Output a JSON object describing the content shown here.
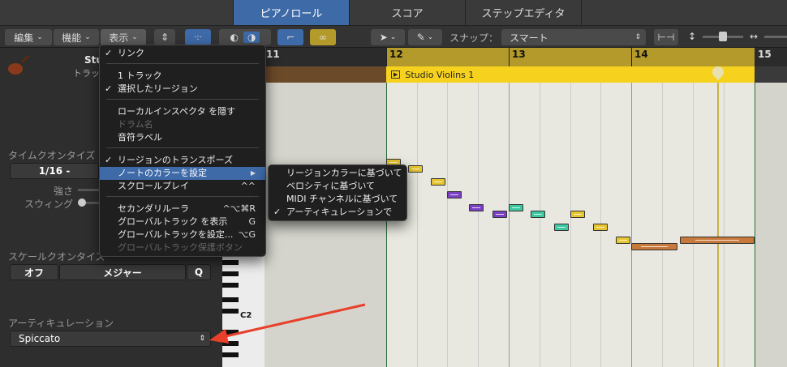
{
  "tabs": [
    {
      "label": "ピアノロール",
      "active": true
    },
    {
      "label": "スコア",
      "active": false
    },
    {
      "label": "ステップエディタ",
      "active": false
    }
  ],
  "toolbar": {
    "edit": "編集",
    "function": "機能",
    "view": "表示",
    "snap_label": "スナップ：",
    "snap_value": "スマート"
  },
  "inspector": {
    "track_title": "Stu",
    "track_subtitle": "トラッ",
    "time_quantize_label": "タイムクオンタイズ",
    "time_quantize_value": "1/16 -",
    "strength_label": "強さ",
    "swing_label": "スウィング",
    "scale_quantize_label": "スケールクオンタイズ",
    "scale_off": "オフ",
    "scale_major": "メジャー",
    "scale_q": "Q",
    "articulation_label": "アーティキュレーション",
    "articulation_value": "Spiccato"
  },
  "piano": {
    "c2_label": "C2"
  },
  "ruler": {
    "bars": [
      "11",
      "12",
      "13",
      "14",
      "15"
    ]
  },
  "region": {
    "name": "Studio Violins 1"
  },
  "view_menu": [
    {
      "label": "リンク",
      "checked": true
    },
    {
      "label": "1 トラック"
    },
    {
      "label": "選択したリージョン",
      "checked": true
    },
    {
      "label": "ローカルインスペクタ を隠す"
    },
    {
      "label": "ドラム名",
      "disabled": true
    },
    {
      "label": "音符ラベル"
    },
    {
      "label": "リージョンのトランスポーズ",
      "checked": true
    },
    {
      "label": "ノートのカラーを設定",
      "highlighted": true,
      "arrow": "▶"
    },
    {
      "label": "スクロールプレイ",
      "shortcut": "^^"
    },
    {
      "label": "セカンダリルーラ",
      "shortcut": "^⌥⌘R"
    },
    {
      "label": "グローバルトラック を表示",
      "shortcut": "G"
    },
    {
      "label": "グローバルトラックを設定...",
      "shortcut": "⌥G"
    },
    {
      "label": "グローバルトラック保護ボタン",
      "disabled": true
    }
  ],
  "color_submenu": [
    {
      "label": "リージョンカラーに基づいて"
    },
    {
      "label": "ベロシティに基づいて"
    },
    {
      "label": "MIDI チャンネルに基づいて"
    },
    {
      "label": "アーティキュレーションで",
      "checked": true
    }
  ],
  "colors": {
    "accent": "#3e6aa8",
    "region": "#f6d21e",
    "note_yellow": "#e6c52e",
    "note_purple": "#7b3fc4",
    "note_teal": "#3cc8a0",
    "note_orange": "#c8783a",
    "arrow": "#e8402a"
  }
}
